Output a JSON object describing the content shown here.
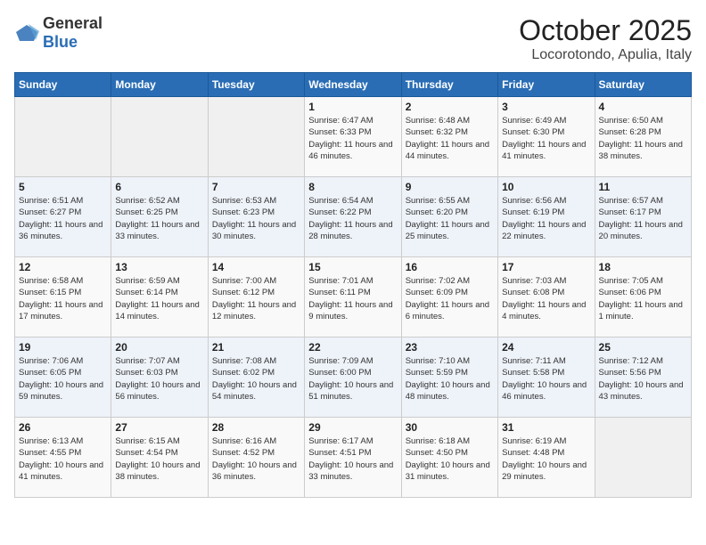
{
  "header": {
    "logo_general": "General",
    "logo_blue": "Blue",
    "title": "October 2025",
    "subtitle": "Locorotondo, Apulia, Italy"
  },
  "weekdays": [
    "Sunday",
    "Monday",
    "Tuesday",
    "Wednesday",
    "Thursday",
    "Friday",
    "Saturday"
  ],
  "weeks": [
    [
      {
        "day": "",
        "sunrise": "",
        "sunset": "",
        "daylight": ""
      },
      {
        "day": "",
        "sunrise": "",
        "sunset": "",
        "daylight": ""
      },
      {
        "day": "",
        "sunrise": "",
        "sunset": "",
        "daylight": ""
      },
      {
        "day": "1",
        "sunrise": "Sunrise: 6:47 AM",
        "sunset": "Sunset: 6:33 PM",
        "daylight": "Daylight: 11 hours and 46 minutes."
      },
      {
        "day": "2",
        "sunrise": "Sunrise: 6:48 AM",
        "sunset": "Sunset: 6:32 PM",
        "daylight": "Daylight: 11 hours and 44 minutes."
      },
      {
        "day": "3",
        "sunrise": "Sunrise: 6:49 AM",
        "sunset": "Sunset: 6:30 PM",
        "daylight": "Daylight: 11 hours and 41 minutes."
      },
      {
        "day": "4",
        "sunrise": "Sunrise: 6:50 AM",
        "sunset": "Sunset: 6:28 PM",
        "daylight": "Daylight: 11 hours and 38 minutes."
      }
    ],
    [
      {
        "day": "5",
        "sunrise": "Sunrise: 6:51 AM",
        "sunset": "Sunset: 6:27 PM",
        "daylight": "Daylight: 11 hours and 36 minutes."
      },
      {
        "day": "6",
        "sunrise": "Sunrise: 6:52 AM",
        "sunset": "Sunset: 6:25 PM",
        "daylight": "Daylight: 11 hours and 33 minutes."
      },
      {
        "day": "7",
        "sunrise": "Sunrise: 6:53 AM",
        "sunset": "Sunset: 6:23 PM",
        "daylight": "Daylight: 11 hours and 30 minutes."
      },
      {
        "day": "8",
        "sunrise": "Sunrise: 6:54 AM",
        "sunset": "Sunset: 6:22 PM",
        "daylight": "Daylight: 11 hours and 28 minutes."
      },
      {
        "day": "9",
        "sunrise": "Sunrise: 6:55 AM",
        "sunset": "Sunset: 6:20 PM",
        "daylight": "Daylight: 11 hours and 25 minutes."
      },
      {
        "day": "10",
        "sunrise": "Sunrise: 6:56 AM",
        "sunset": "Sunset: 6:19 PM",
        "daylight": "Daylight: 11 hours and 22 minutes."
      },
      {
        "day": "11",
        "sunrise": "Sunrise: 6:57 AM",
        "sunset": "Sunset: 6:17 PM",
        "daylight": "Daylight: 11 hours and 20 minutes."
      }
    ],
    [
      {
        "day": "12",
        "sunrise": "Sunrise: 6:58 AM",
        "sunset": "Sunset: 6:15 PM",
        "daylight": "Daylight: 11 hours and 17 minutes."
      },
      {
        "day": "13",
        "sunrise": "Sunrise: 6:59 AM",
        "sunset": "Sunset: 6:14 PM",
        "daylight": "Daylight: 11 hours and 14 minutes."
      },
      {
        "day": "14",
        "sunrise": "Sunrise: 7:00 AM",
        "sunset": "Sunset: 6:12 PM",
        "daylight": "Daylight: 11 hours and 12 minutes."
      },
      {
        "day": "15",
        "sunrise": "Sunrise: 7:01 AM",
        "sunset": "Sunset: 6:11 PM",
        "daylight": "Daylight: 11 hours and 9 minutes."
      },
      {
        "day": "16",
        "sunrise": "Sunrise: 7:02 AM",
        "sunset": "Sunset: 6:09 PM",
        "daylight": "Daylight: 11 hours and 6 minutes."
      },
      {
        "day": "17",
        "sunrise": "Sunrise: 7:03 AM",
        "sunset": "Sunset: 6:08 PM",
        "daylight": "Daylight: 11 hours and 4 minutes."
      },
      {
        "day": "18",
        "sunrise": "Sunrise: 7:05 AM",
        "sunset": "Sunset: 6:06 PM",
        "daylight": "Daylight: 11 hours and 1 minute."
      }
    ],
    [
      {
        "day": "19",
        "sunrise": "Sunrise: 7:06 AM",
        "sunset": "Sunset: 6:05 PM",
        "daylight": "Daylight: 10 hours and 59 minutes."
      },
      {
        "day": "20",
        "sunrise": "Sunrise: 7:07 AM",
        "sunset": "Sunset: 6:03 PM",
        "daylight": "Daylight: 10 hours and 56 minutes."
      },
      {
        "day": "21",
        "sunrise": "Sunrise: 7:08 AM",
        "sunset": "Sunset: 6:02 PM",
        "daylight": "Daylight: 10 hours and 54 minutes."
      },
      {
        "day": "22",
        "sunrise": "Sunrise: 7:09 AM",
        "sunset": "Sunset: 6:00 PM",
        "daylight": "Daylight: 10 hours and 51 minutes."
      },
      {
        "day": "23",
        "sunrise": "Sunrise: 7:10 AM",
        "sunset": "Sunset: 5:59 PM",
        "daylight": "Daylight: 10 hours and 48 minutes."
      },
      {
        "day": "24",
        "sunrise": "Sunrise: 7:11 AM",
        "sunset": "Sunset: 5:58 PM",
        "daylight": "Daylight: 10 hours and 46 minutes."
      },
      {
        "day": "25",
        "sunrise": "Sunrise: 7:12 AM",
        "sunset": "Sunset: 5:56 PM",
        "daylight": "Daylight: 10 hours and 43 minutes."
      }
    ],
    [
      {
        "day": "26",
        "sunrise": "Sunrise: 6:13 AM",
        "sunset": "Sunset: 4:55 PM",
        "daylight": "Daylight: 10 hours and 41 minutes."
      },
      {
        "day": "27",
        "sunrise": "Sunrise: 6:15 AM",
        "sunset": "Sunset: 4:54 PM",
        "daylight": "Daylight: 10 hours and 38 minutes."
      },
      {
        "day": "28",
        "sunrise": "Sunrise: 6:16 AM",
        "sunset": "Sunset: 4:52 PM",
        "daylight": "Daylight: 10 hours and 36 minutes."
      },
      {
        "day": "29",
        "sunrise": "Sunrise: 6:17 AM",
        "sunset": "Sunset: 4:51 PM",
        "daylight": "Daylight: 10 hours and 33 minutes."
      },
      {
        "day": "30",
        "sunrise": "Sunrise: 6:18 AM",
        "sunset": "Sunset: 4:50 PM",
        "daylight": "Daylight: 10 hours and 31 minutes."
      },
      {
        "day": "31",
        "sunrise": "Sunrise: 6:19 AM",
        "sunset": "Sunset: 4:48 PM",
        "daylight": "Daylight: 10 hours and 29 minutes."
      },
      {
        "day": "",
        "sunrise": "",
        "sunset": "",
        "daylight": ""
      }
    ]
  ]
}
